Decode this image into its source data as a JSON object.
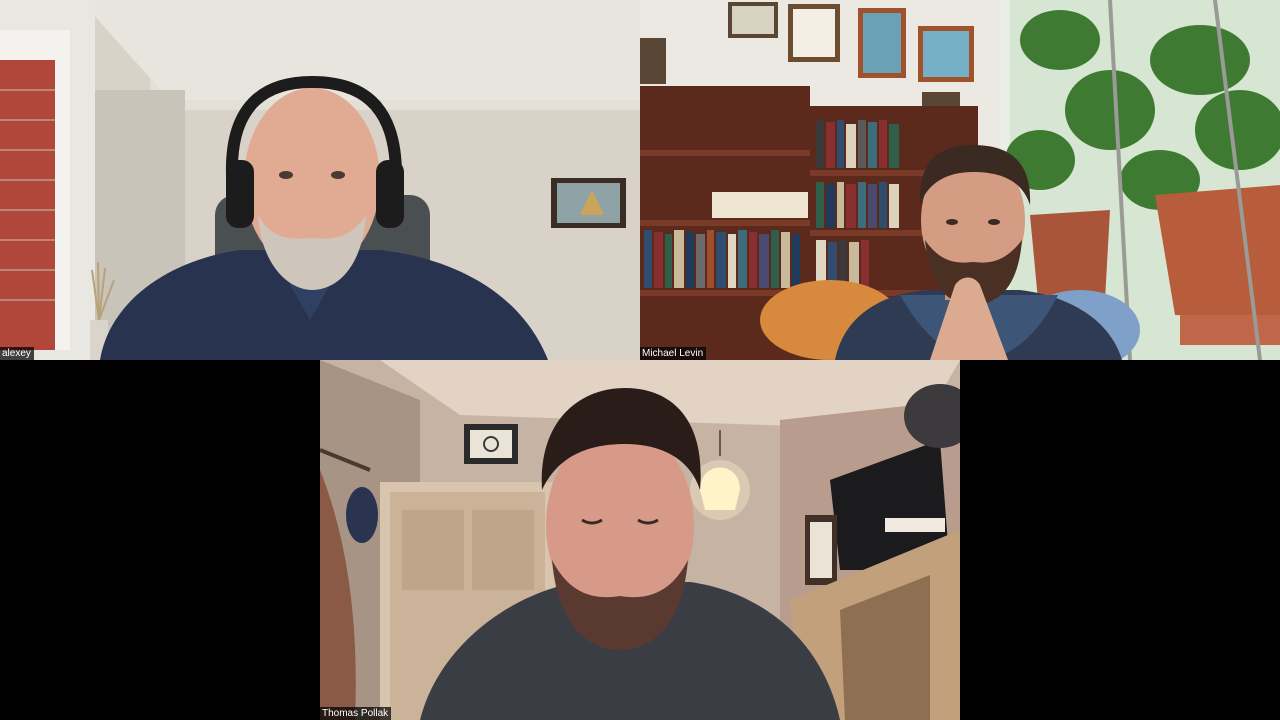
{
  "participants": [
    {
      "name": "alexey"
    },
    {
      "name": "Michael Levin"
    },
    {
      "name": "Thomas Pollak"
    }
  ],
  "colors": {
    "background": "#000000",
    "label_background": "rgba(0,0,0,0.72)",
    "label_text": "#ffffff"
  }
}
